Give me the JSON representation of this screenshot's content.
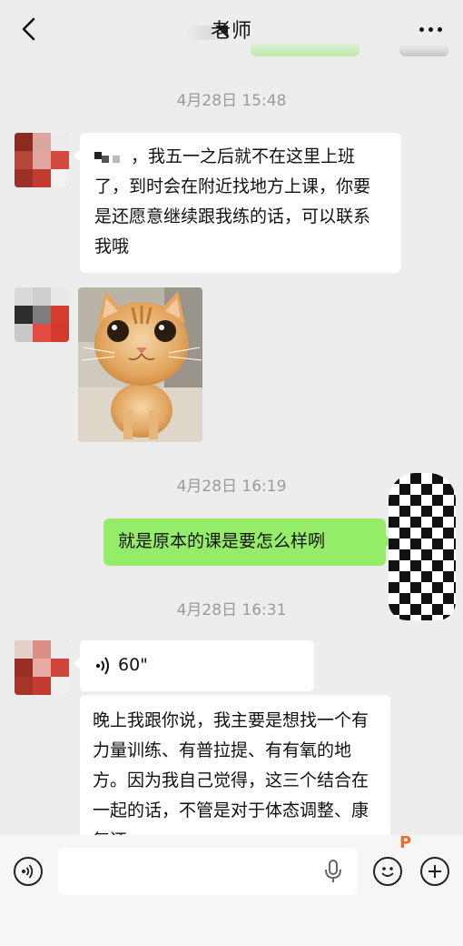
{
  "header": {
    "title": "老师"
  },
  "messages": {
    "ts1": "4月28日 15:48",
    "msg1": "，我五一之后就不在这里上班了，到时会在附近找地方上课，你要是还愿意继续跟我练的话，可以联系我哦",
    "ts2": "4月28日 16:19",
    "msg2": "就是原本的课是要怎么样咧",
    "ts3": "4月28日 16:31",
    "voice_duration": "60\"",
    "msg3": "晚上我跟你说，我主要是想找一个有力量训练、有普拉提、有有氧的地方。因为我自己觉得，这三个结合在一起的话，不管是对于体态调整、康复还"
  },
  "input": {
    "value": "",
    "placeholder": ""
  },
  "watermark": "P",
  "icons": {
    "back": "chevron-left-icon",
    "more": "more-dots-icon",
    "voice": "voice-icon",
    "mic": "mic-icon",
    "emoji": "emoji-icon",
    "add": "plus-icon"
  },
  "colors": {
    "background": "#ededed",
    "outgoing_bubble": "#95ec69",
    "incoming_bubble": "#ffffff",
    "timestamp": "#9b9b9b"
  }
}
